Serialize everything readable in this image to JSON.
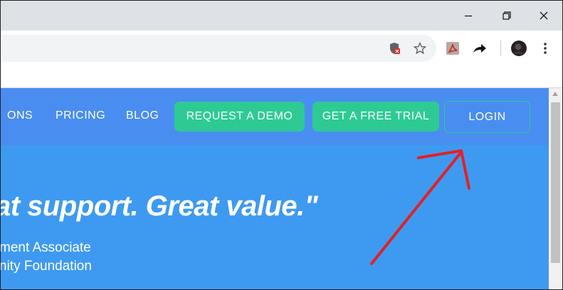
{
  "window": {
    "minimize_icon": "minimize-icon",
    "restore_icon": "restore-icon",
    "close_icon": "close-icon"
  },
  "toolbar": {
    "icons": [
      "shield-blocked-icon",
      "star-bookmark-icon",
      "pdf-extension-icon",
      "share-arrow-icon",
      "profile-avatar-icon",
      "kebab-menu-icon"
    ]
  },
  "nav": {
    "items": [
      {
        "label": "ONS"
      },
      {
        "label": "PRICING"
      },
      {
        "label": "BLOG"
      }
    ],
    "request_demo": "REQUEST A DEMO",
    "free_trial": "GET A FREE TRIAL",
    "login": "LOGIN"
  },
  "hero": {
    "quote": "at support. Great value.\"",
    "attribution_line1": "ment Associate",
    "attribution_line2": "nity Foundation"
  },
  "colors": {
    "nav_bg": "#4a8df0",
    "hero_bg": "#3e9af0",
    "accent_green": "#2dcb93",
    "annotation_red": "#e32027"
  }
}
